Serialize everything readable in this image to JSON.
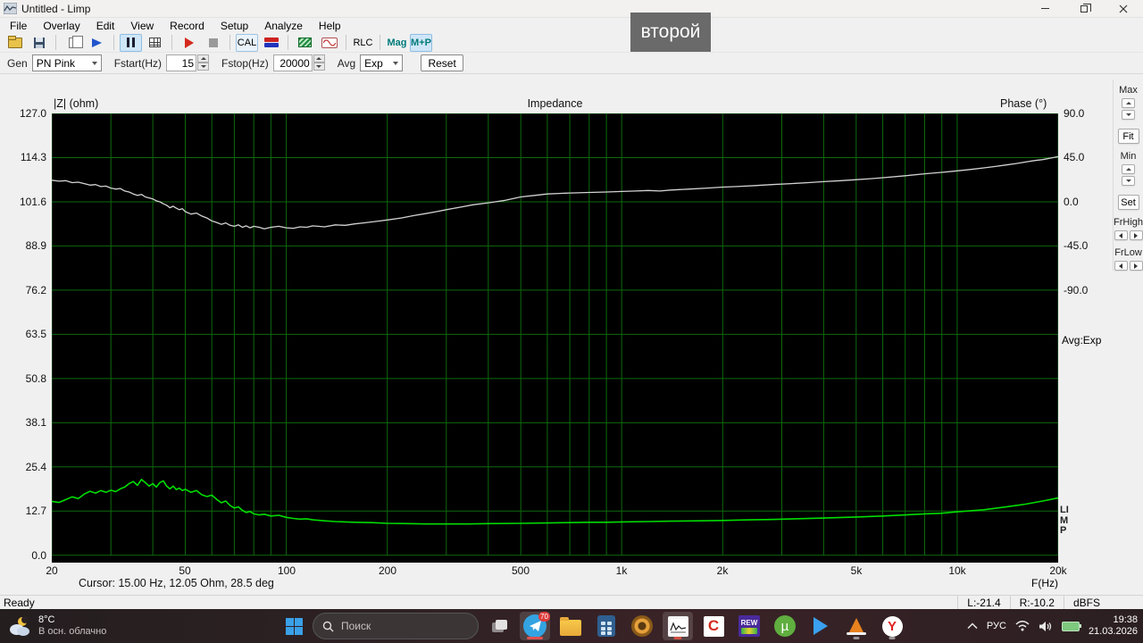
{
  "window": {
    "title": "Untitled - Limp"
  },
  "menu": {
    "items": [
      "File",
      "Overlay",
      "Edit",
      "View",
      "Record",
      "Setup",
      "Analyze",
      "Help"
    ]
  },
  "toolbar": {
    "cal_label": "CAL",
    "rlc_label": "RLC",
    "mag_label": "Mag",
    "mp_label": "M+P"
  },
  "params": {
    "gen_label": "Gen",
    "gen_value": "PN Pink",
    "fstart_label": "Fstart(Hz)",
    "fstart_value": "15",
    "fstop_label": "Fstop(Hz)",
    "fstop_value": "20000",
    "avg_label": "Avg",
    "avg_value": "Exp",
    "reset_label": "Reset"
  },
  "overlay_caption": "второй",
  "chart": {
    "title": "Impedance",
    "left_axis_title": "|Z| (ohm)",
    "right_axis_title": "Phase (°)",
    "x_axis_title": "F(Hz)",
    "cursor_text": "Cursor: 15.00 Hz, 12.05 Ohm, 28.5 deg",
    "avg_text": "Avg:Exp",
    "limp_vertical": "LIMP"
  },
  "side_panel": {
    "max_label": "Max",
    "fit_label": "Fit",
    "min_label": "Min",
    "set_label": "Set",
    "frhigh_label": "FrHigh",
    "frlow_label": "FrLow"
  },
  "status_bar": {
    "ready": "Ready",
    "left_level": "L:-21.4",
    "right_level": "R:-10.2",
    "unit": "dBFS"
  },
  "taskbar": {
    "weather": {
      "temp": "8°C",
      "condition": "В осн. облачно"
    },
    "search_placeholder": "Поиск",
    "telegram_badge": "70",
    "icon_glyphs": {
      "c": "C",
      "rew": "REW",
      "utorrent": "µ",
      "yandex": "Y"
    },
    "tray": {
      "language": "РУС",
      "time": "19:38",
      "date": "21.03.2026"
    }
  },
  "chart_data": {
    "type": "line",
    "title": "Impedance",
    "xlabel": "F(Hz)",
    "x_scale": "log",
    "x_range": [
      20,
      20000
    ],
    "x_ticks": [
      "20",
      "50",
      "100",
      "200",
      "500",
      "1k",
      "2k",
      "5k",
      "10k",
      "20k"
    ],
    "x_tick_freqs": [
      20,
      50,
      100,
      200,
      500,
      1000,
      2000,
      5000,
      10000,
      20000
    ],
    "grid": true,
    "grid_color": "#0d6a0d",
    "y_left": {
      "label": "|Z| (ohm)",
      "range": [
        0,
        127
      ],
      "ohm_per_div": 12.7,
      "ticks": [
        "127.0",
        "114.3",
        "101.6",
        "88.9",
        "76.2",
        "63.5",
        "50.8",
        "38.1",
        "25.4",
        "12.7",
        "0.0"
      ]
    },
    "y_right": {
      "label": "Phase (°)",
      "deg_per_div": 45,
      "zero_deg_div": 2,
      "ticks": [
        "90.0",
        "45.0",
        "0.0",
        "-45.0",
        "-90.0"
      ]
    },
    "series": [
      {
        "name": "impedance",
        "unit": "ohm",
        "color": "#00dc00",
        "width": 1.6,
        "axis": "left",
        "points": [
          [
            20,
            15.5
          ],
          [
            21,
            15.2
          ],
          [
            22,
            16
          ],
          [
            23,
            16.8
          ],
          [
            24,
            16.3
          ],
          [
            25,
            17.6
          ],
          [
            26,
            18.4
          ],
          [
            27,
            17.9
          ],
          [
            28,
            18.6
          ],
          [
            29,
            18.1
          ],
          [
            30,
            18.7
          ],
          [
            31,
            18.3
          ],
          [
            32,
            19.1
          ],
          [
            33,
            19.6
          ],
          [
            34,
            20.6
          ],
          [
            35,
            21.2
          ],
          [
            36,
            20.1
          ],
          [
            37,
            21.8
          ],
          [
            38,
            20.9
          ],
          [
            39,
            19.9
          ],
          [
            40,
            20.6
          ],
          [
            41,
            19.6
          ],
          [
            42,
            20.9
          ],
          [
            43,
            21.4
          ],
          [
            44,
            19.9
          ],
          [
            45,
            19.1
          ],
          [
            46,
            19.9
          ],
          [
            47,
            18.9
          ],
          [
            48,
            19.3
          ],
          [
            49,
            18.6
          ],
          [
            50,
            19
          ],
          [
            52,
            18.1
          ],
          [
            54,
            18.6
          ],
          [
            56,
            17.4
          ],
          [
            58,
            16.9
          ],
          [
            60,
            17.3
          ],
          [
            62,
            16.1
          ],
          [
            64,
            15.1
          ],
          [
            66,
            15.6
          ],
          [
            68,
            14.3
          ],
          [
            70,
            13.6
          ],
          [
            72,
            13.9
          ],
          [
            74,
            12.9
          ],
          [
            76,
            12.3
          ],
          [
            78,
            12.6
          ],
          [
            80,
            11.9
          ],
          [
            83,
            11.6
          ],
          [
            86,
            11.8
          ],
          [
            90,
            11.3
          ],
          [
            95,
            11.5
          ],
          [
            100,
            10.9
          ],
          [
            105,
            10.6
          ],
          [
            110,
            10.4
          ],
          [
            115,
            10.5
          ],
          [
            120,
            10.2
          ],
          [
            130,
            9.9
          ],
          [
            140,
            9.7
          ],
          [
            150,
            9.6
          ],
          [
            160,
            9.5
          ],
          [
            180,
            9.4
          ],
          [
            200,
            9.2
          ],
          [
            230,
            9.1
          ],
          [
            260,
            9
          ],
          [
            300,
            9
          ],
          [
            350,
            9
          ],
          [
            400,
            9.1
          ],
          [
            500,
            9.2
          ],
          [
            600,
            9.3
          ],
          [
            700,
            9.4
          ],
          [
            800,
            9.5
          ],
          [
            900,
            9.5
          ],
          [
            1000,
            9.6
          ],
          [
            1200,
            9.7
          ],
          [
            1400,
            9.8
          ],
          [
            1700,
            9.9
          ],
          [
            2000,
            10
          ],
          [
            2400,
            10.2
          ],
          [
            2800,
            10.3
          ],
          [
            3300,
            10.5
          ],
          [
            4000,
            10.7
          ],
          [
            5000,
            11
          ],
          [
            6000,
            11.3
          ],
          [
            7000,
            11.6
          ],
          [
            8000,
            11.9
          ],
          [
            9000,
            12.1
          ],
          [
            10000,
            12.5
          ],
          [
            11000,
            12.8
          ],
          [
            12000,
            13.1
          ],
          [
            14000,
            13.9
          ],
          [
            16000,
            14.7
          ],
          [
            18000,
            15.6
          ],
          [
            20000,
            16.5
          ]
        ]
      },
      {
        "name": "phase",
        "unit": "deg",
        "color": "#d2d2d2",
        "width": 1.3,
        "axis": "right",
        "points": [
          [
            20,
            22
          ],
          [
            21,
            21
          ],
          [
            22,
            21.5
          ],
          [
            23,
            19.5
          ],
          [
            24,
            20
          ],
          [
            25,
            18.5
          ],
          [
            26,
            17
          ],
          [
            27,
            17.5
          ],
          [
            28,
            15.5
          ],
          [
            29,
            16
          ],
          [
            30,
            14
          ],
          [
            31,
            13
          ],
          [
            32,
            13.5
          ],
          [
            33,
            11
          ],
          [
            34,
            10
          ],
          [
            35,
            8
          ],
          [
            36,
            6.5
          ],
          [
            37,
            7.5
          ],
          [
            38,
            5
          ],
          [
            39,
            4
          ],
          [
            40,
            3
          ],
          [
            41,
            1
          ],
          [
            42,
            0
          ],
          [
            43,
            -2
          ],
          [
            44,
            -3.5
          ],
          [
            45,
            -6
          ],
          [
            46,
            -4.5
          ],
          [
            47,
            -6.5
          ],
          [
            48,
            -8
          ],
          [
            49,
            -7
          ],
          [
            50,
            -10
          ],
          [
            52,
            -12.5
          ],
          [
            54,
            -11.5
          ],
          [
            56,
            -14.5
          ],
          [
            58,
            -16.5
          ],
          [
            60,
            -19.5
          ],
          [
            62,
            -21
          ],
          [
            64,
            -23
          ],
          [
            66,
            -21.5
          ],
          [
            68,
            -24
          ],
          [
            70,
            -25
          ],
          [
            72,
            -23.5
          ],
          [
            74,
            -26
          ],
          [
            76,
            -24.5
          ],
          [
            78,
            -26.5
          ],
          [
            80,
            -25
          ],
          [
            83,
            -26
          ],
          [
            86,
            -27.5
          ],
          [
            90,
            -26
          ],
          [
            95,
            -25
          ],
          [
            100,
            -26.5
          ],
          [
            105,
            -27
          ],
          [
            110,
            -25.5
          ],
          [
            115,
            -26
          ],
          [
            120,
            -24.5
          ],
          [
            130,
            -25.5
          ],
          [
            140,
            -23.5
          ],
          [
            150,
            -24
          ],
          [
            160,
            -22.5
          ],
          [
            170,
            -21.5
          ],
          [
            180,
            -20.5
          ],
          [
            190,
            -19.5
          ],
          [
            200,
            -18.5
          ],
          [
            220,
            -16.5
          ],
          [
            240,
            -14
          ],
          [
            260,
            -12
          ],
          [
            280,
            -10
          ],
          [
            300,
            -8
          ],
          [
            330,
            -5.5
          ],
          [
            360,
            -3
          ],
          [
            400,
            -1
          ],
          [
            450,
            1.5
          ],
          [
            500,
            5
          ],
          [
            550,
            6.5
          ],
          [
            600,
            8
          ],
          [
            650,
            8.5
          ],
          [
            700,
            9
          ],
          [
            800,
            9.5
          ],
          [
            900,
            10
          ],
          [
            1000,
            10.5
          ],
          [
            1100,
            11
          ],
          [
            1200,
            11.5
          ],
          [
            1300,
            11
          ],
          [
            1400,
            12
          ],
          [
            1600,
            13
          ],
          [
            1800,
            14
          ],
          [
            2000,
            15
          ],
          [
            2200,
            15.5
          ],
          [
            2500,
            16.5
          ],
          [
            2800,
            17.5
          ],
          [
            3200,
            18.5
          ],
          [
            3600,
            19.5
          ],
          [
            4000,
            20.5
          ],
          [
            4500,
            21.5
          ],
          [
            5000,
            22.5
          ],
          [
            5500,
            23.5
          ],
          [
            6000,
            24.5
          ],
          [
            7000,
            26.5
          ],
          [
            8000,
            28.5
          ],
          [
            9000,
            30
          ],
          [
            10000,
            31.5
          ],
          [
            11000,
            33
          ],
          [
            12000,
            34.5
          ],
          [
            13000,
            36
          ],
          [
            14000,
            37.5
          ],
          [
            15000,
            39
          ],
          [
            16000,
            40.5
          ],
          [
            17000,
            42
          ],
          [
            18000,
            43
          ],
          [
            19000,
            44.5
          ],
          [
            20000,
            46
          ]
        ]
      }
    ]
  }
}
